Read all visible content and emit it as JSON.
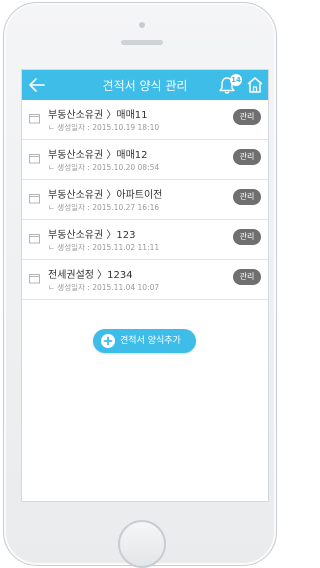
{
  "header": {
    "title": "견적서 양식 관리",
    "notification_count": "14"
  },
  "list": {
    "meta_prefix": "생성일자 : ",
    "manage_label": "관리",
    "items": [
      {
        "title": "부동산소유권 〉매매11",
        "date": "2015.10.19 18:10"
      },
      {
        "title": "부동산소유권 〉매매12",
        "date": "2015.10.20 08:54"
      },
      {
        "title": "부동산소유권 〉아파트이전",
        "date": "2015.10.27 16:16"
      },
      {
        "title": "부동산소유권 〉123",
        "date": "2015.11.02 11:11"
      },
      {
        "title": "전세권설정 〉1234",
        "date": "2015.11.04 10:07"
      }
    ]
  },
  "add_button": {
    "label": "견적서 양식추가"
  },
  "colors": {
    "accent": "#3fbde9",
    "manage_button": "#6f6f6f"
  },
  "icons": {
    "back": "arrow-left-icon",
    "bell": "bell-icon",
    "home": "home-icon",
    "row": "folder-icon",
    "add": "plus-circle-icon"
  }
}
